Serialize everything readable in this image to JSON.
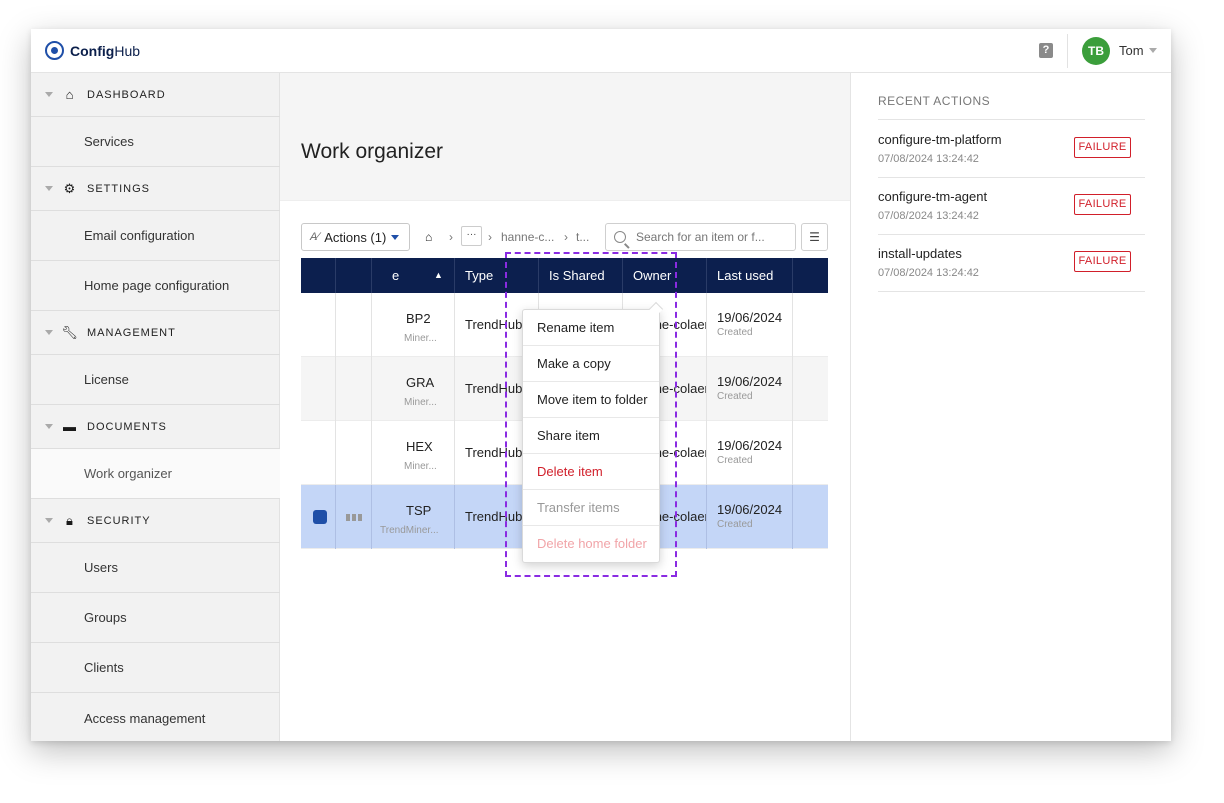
{
  "app": {
    "name_prefix": "Config",
    "name_suffix": "Hub"
  },
  "user": {
    "initials": "TB",
    "name": "Tom"
  },
  "sidebar": {
    "sections": [
      {
        "label": "DASHBOARD",
        "items": [
          "Services"
        ]
      },
      {
        "label": "SETTINGS",
        "items": [
          "Email configuration",
          "Home page configuration"
        ]
      },
      {
        "label": "MANAGEMENT",
        "items": [
          "License"
        ]
      },
      {
        "label": "DOCUMENTS",
        "items": [
          "Work organizer"
        ]
      },
      {
        "label": "SECURITY",
        "items": [
          "Users",
          "Groups",
          "Clients",
          "Access management"
        ]
      }
    ],
    "active_item": "Work organizer"
  },
  "main": {
    "title": "Work organizer",
    "actions_label": "Actions (1)",
    "breadcrumb": {
      "more": "···",
      "user": "hanne-c...",
      "last": "t..."
    },
    "search_placeholder": "Search for an item or f...",
    "table": {
      "columns": [
        "e",
        "Type",
        "Is Shared",
        "Owner",
        "Last used"
      ],
      "rows": [
        {
          "name": "BP2",
          "sub": "Miner...",
          "type": "TrendHub vie",
          "shared": "",
          "owner": "hanne-colaers",
          "date": "19/06/2024",
          "date_sub": "Created",
          "selected": false
        },
        {
          "name": "GRA",
          "sub": "Miner...",
          "type": "TrendHub vie",
          "shared": "",
          "owner": "hanne-colaers",
          "date": "19/06/2024",
          "date_sub": "Created",
          "selected": false
        },
        {
          "name": "HEX",
          "sub": "Miner...",
          "type": "TrendHub vie",
          "shared": "",
          "owner": "hanne-colaers",
          "date": "19/06/2024",
          "date_sub": "Created",
          "selected": false
        },
        {
          "name": "TSP",
          "sub": "TrendMiner...",
          "type": "TrendHub vie",
          "shared": "",
          "owner": "hanne-colaers",
          "date": "19/06/2024",
          "date_sub": "Created",
          "selected": true
        }
      ]
    },
    "menu": [
      {
        "label": "Rename item",
        "state": "normal"
      },
      {
        "label": "Make a copy",
        "state": "normal"
      },
      {
        "label": "Move item to folder",
        "state": "normal"
      },
      {
        "label": "Share item",
        "state": "normal"
      },
      {
        "label": "Delete item",
        "state": "danger"
      },
      {
        "label": "Transfer items",
        "state": "disabled"
      },
      {
        "label": "Delete home folder",
        "state": "danger-disabled"
      }
    ]
  },
  "recent": {
    "title": "RECENT ACTIONS",
    "items": [
      {
        "name": "configure-tm-platform",
        "time": "07/08/2024 13:24:42",
        "status": "FAILURE"
      },
      {
        "name": "configure-tm-agent",
        "time": "07/08/2024 13:24:42",
        "status": "FAILURE"
      },
      {
        "name": "install-updates",
        "time": "07/08/2024 13:24:42",
        "status": "FAILURE"
      }
    ]
  },
  "colors": {
    "brand": "#1f4fa8",
    "header_dark": "#0c1f4e",
    "failure": "#d11f2a",
    "selected_row": "#c4d6f7",
    "highlight_dash": "#8a2be2"
  }
}
